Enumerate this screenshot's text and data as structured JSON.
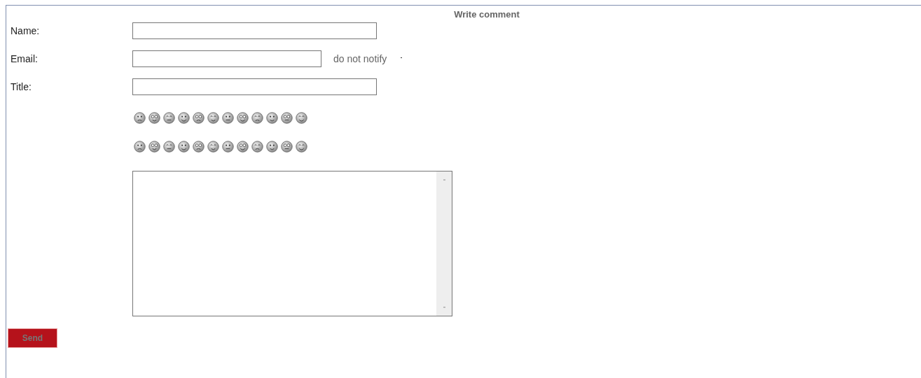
{
  "form": {
    "title": "Write comment",
    "fields": [
      {
        "label": "Name:",
        "kind": "wide"
      },
      {
        "label": "Email:",
        "kind": "email",
        "note": "do not notify"
      },
      {
        "label": "Title:",
        "kind": "wide"
      }
    ],
    "send_button": "Send"
  }
}
